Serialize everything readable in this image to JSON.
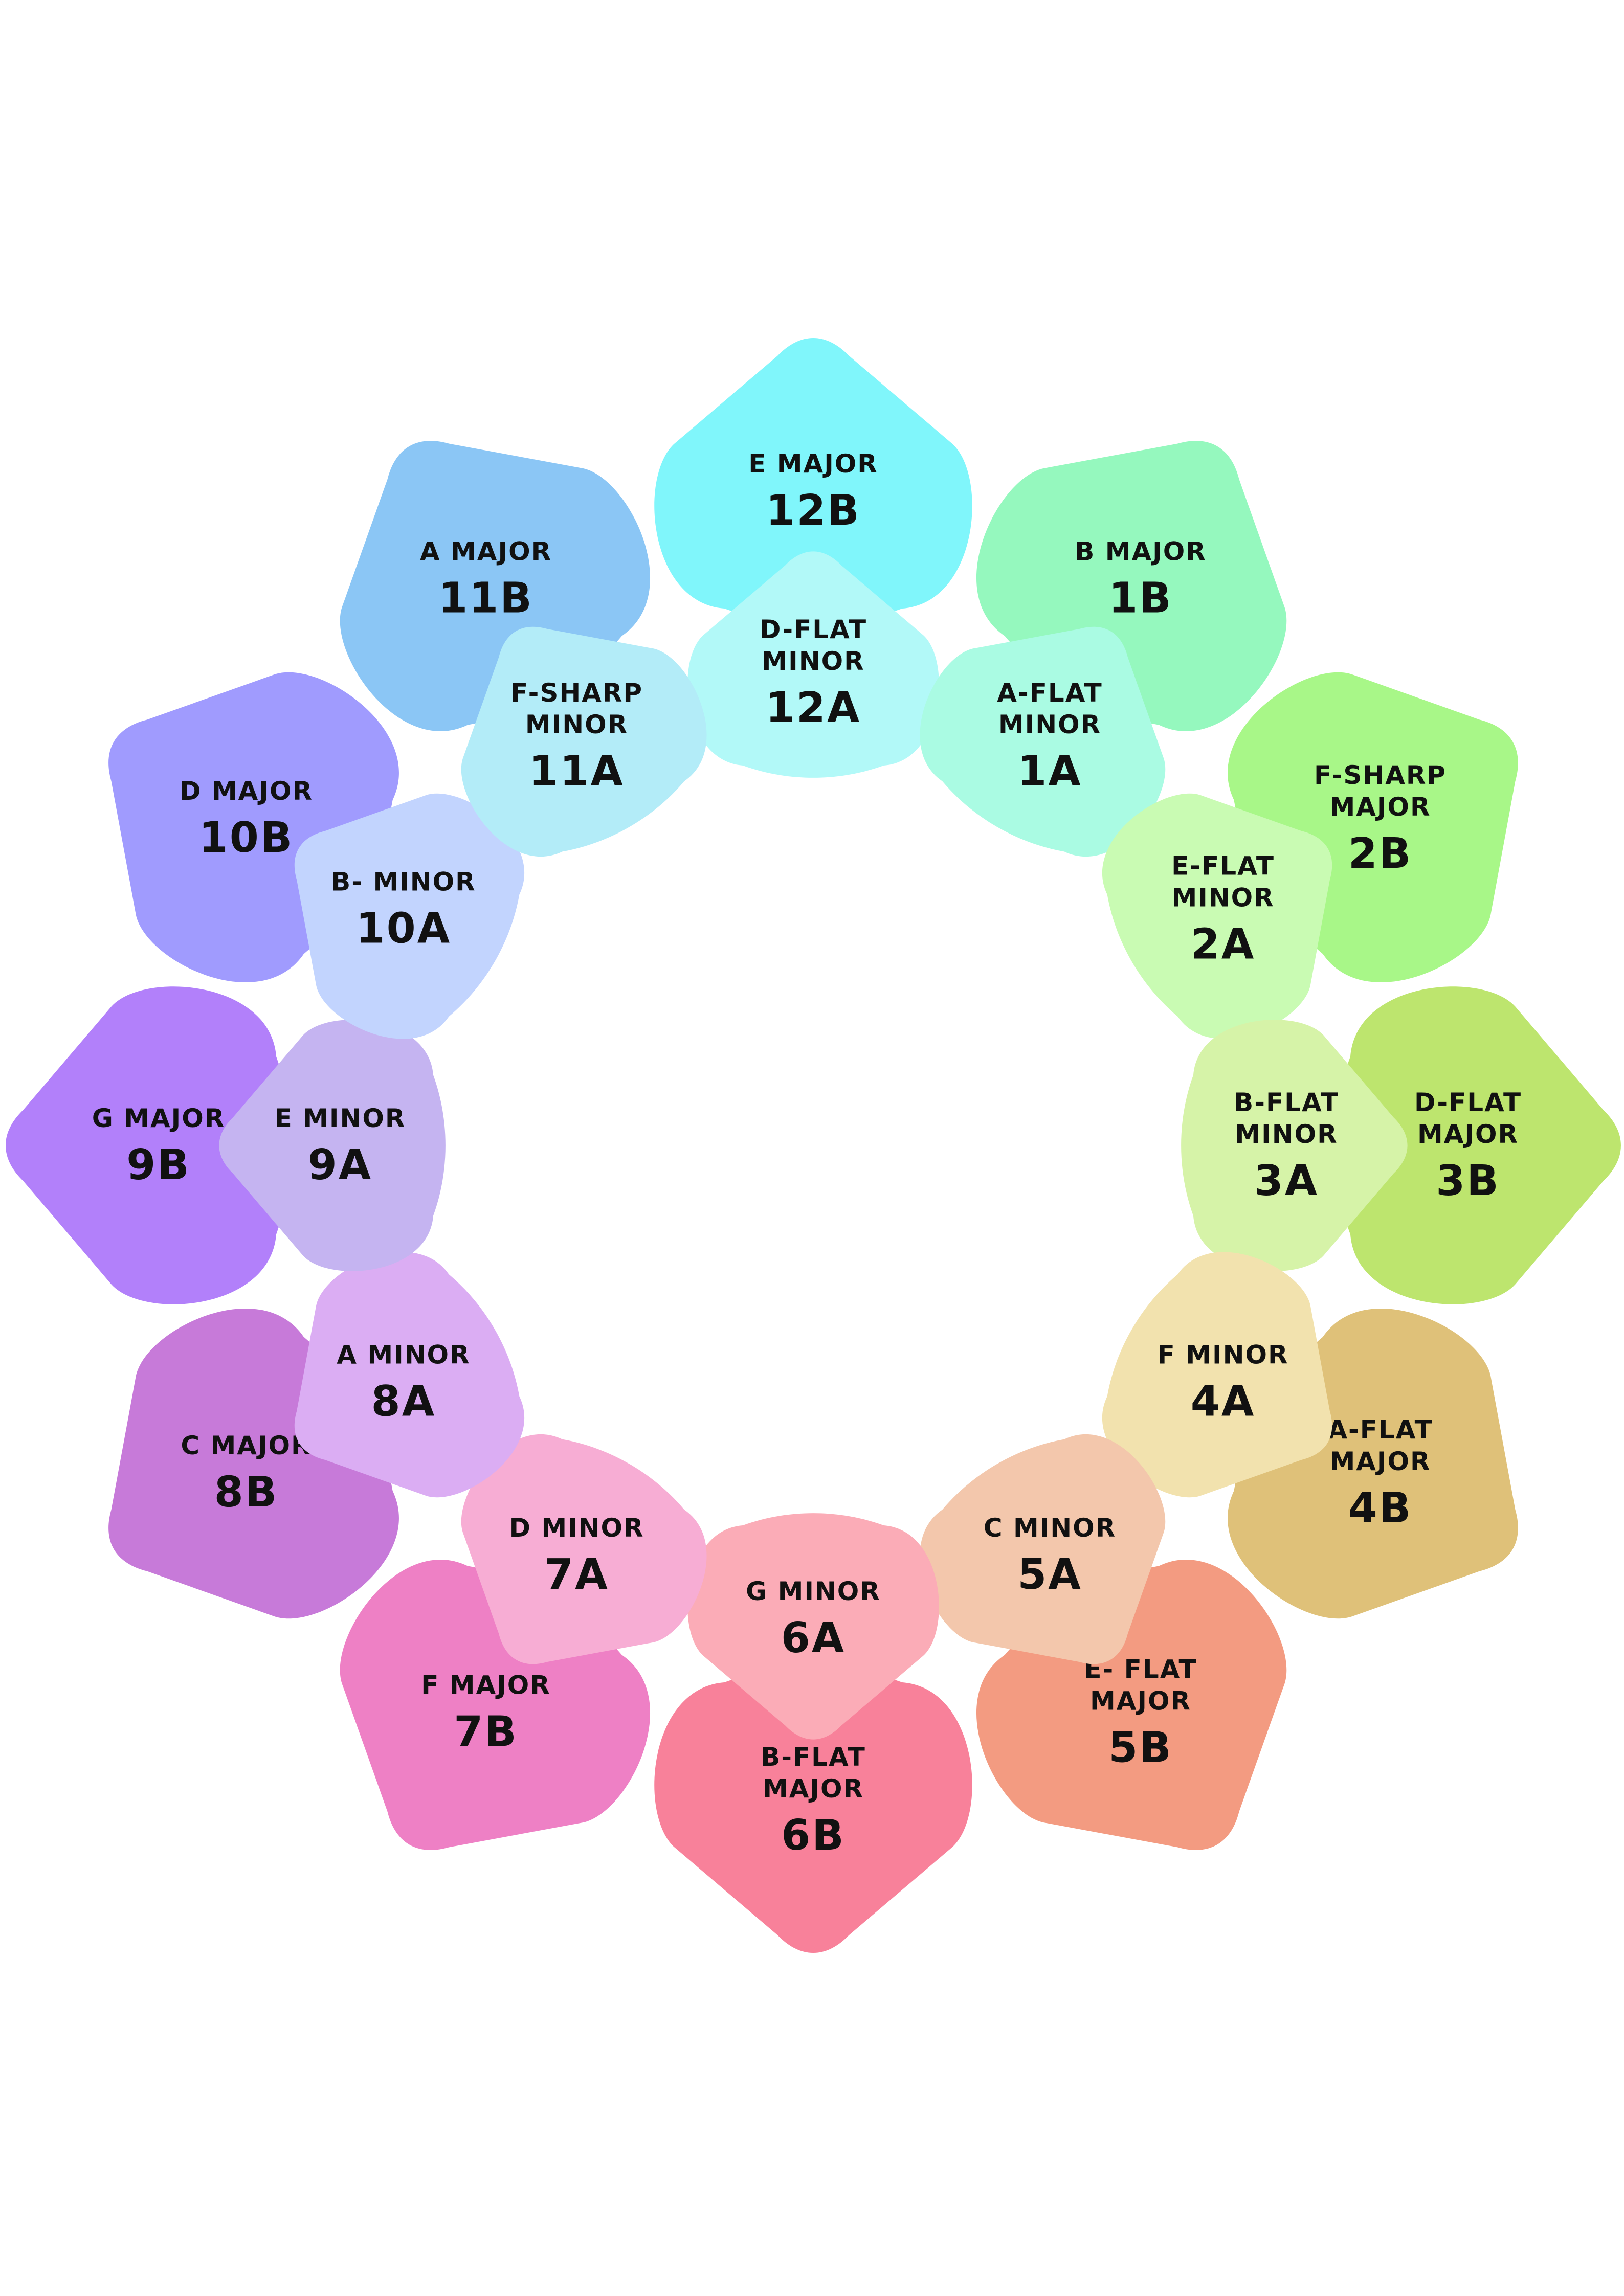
{
  "camelot_wheel": {
    "outer_ring": [
      {
        "code": "12B",
        "name_lines": [
          "E MAJOR"
        ],
        "color": "#80F6FB"
      },
      {
        "code": "1B",
        "name_lines": [
          "B MAJOR"
        ],
        "color": "#95F8BE"
      },
      {
        "code": "2B",
        "name_lines": [
          "F-SHARP",
          "MAJOR"
        ],
        "color": "#A8F788"
      },
      {
        "code": "3B",
        "name_lines": [
          "D-FLAT",
          "MAJOR"
        ],
        "color": "#BDE56E"
      },
      {
        "code": "4B",
        "name_lines": [
          "A-FLAT",
          "MAJOR"
        ],
        "color": "#DFC179"
      },
      {
        "code": "5B",
        "name_lines": [
          "E- FLAT",
          "MAJOR"
        ],
        "color": "#F39B81"
      },
      {
        "code": "6B",
        "name_lines": [
          "B-FLAT",
          "MAJOR"
        ],
        "color": "#F8819A"
      },
      {
        "code": "7B",
        "name_lines": [
          "F MAJOR"
        ],
        "color": "#EE80C5"
      },
      {
        "code": "8B",
        "name_lines": [
          "C MAJOR"
        ],
        "color": "#C77AD9"
      },
      {
        "code": "9B",
        "name_lines": [
          "G MAJOR"
        ],
        "color": "#B280FA"
      },
      {
        "code": "10B",
        "name_lines": [
          "D MAJOR"
        ],
        "color": "#A09BFE"
      },
      {
        "code": "11B",
        "name_lines": [
          "A MAJOR"
        ],
        "color": "#8BC6F5"
      }
    ],
    "inner_ring": [
      {
        "code": "12A",
        "name_lines": [
          "D-FLAT",
          "MINOR"
        ],
        "color": "#B2F9F8"
      },
      {
        "code": "1A",
        "name_lines": [
          "A-FLAT",
          "MINOR"
        ],
        "color": "#AAFBE3"
      },
      {
        "code": "2A",
        "name_lines": [
          "E-FLAT",
          "MINOR"
        ],
        "color": "#C9FBB3"
      },
      {
        "code": "3A",
        "name_lines": [
          "B-FLAT",
          "MINOR"
        ],
        "color": "#D6F3A8"
      },
      {
        "code": "4A",
        "name_lines": [
          "F MINOR"
        ],
        "color": "#F2E2AE"
      },
      {
        "code": "5A",
        "name_lines": [
          "C MINOR"
        ],
        "color": "#F3C7AC"
      },
      {
        "code": "6A",
        "name_lines": [
          "G MINOR"
        ],
        "color": "#FBACB7"
      },
      {
        "code": "7A",
        "name_lines": [
          "D MINOR"
        ],
        "color": "#F7ADD4"
      },
      {
        "code": "8A",
        "name_lines": [
          "A MINOR"
        ],
        "color": "#DBADF3"
      },
      {
        "code": "9A",
        "name_lines": [
          "E MINOR"
        ],
        "color": "#C5B4F1"
      },
      {
        "code": "10A",
        "name_lines": [
          "B- MINOR"
        ],
        "color": "#C2D4FE"
      },
      {
        "code": "11A",
        "name_lines": [
          "F-SHARP",
          "MINOR"
        ],
        "color": "#B3ECF8"
      }
    ]
  }
}
